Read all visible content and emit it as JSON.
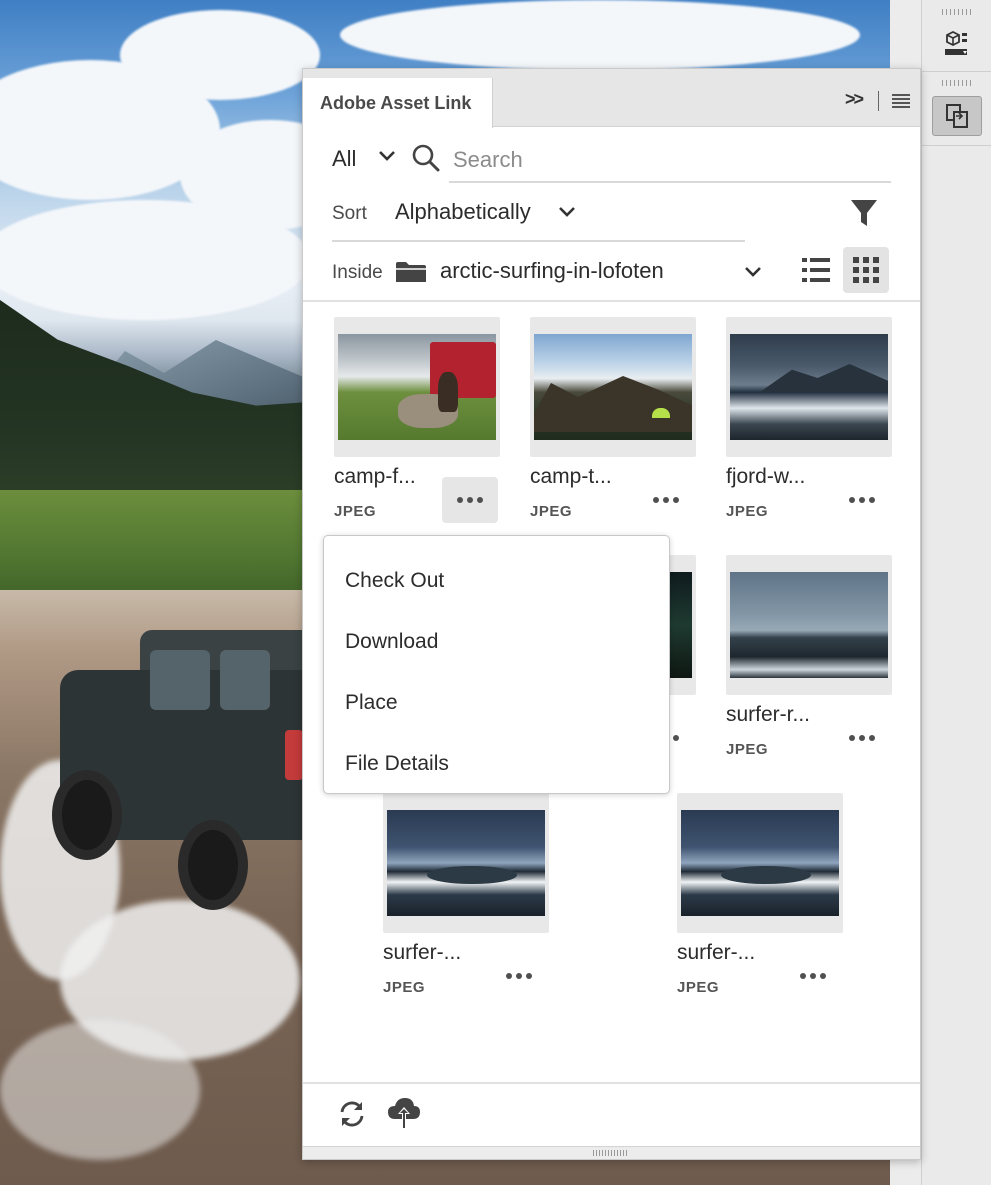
{
  "panel": {
    "title": "Adobe Asset Link",
    "collapse_glyph": ">>"
  },
  "search": {
    "scope": "All",
    "placeholder": "Search",
    "value": ""
  },
  "sort": {
    "label": "Sort",
    "value": "Alphabetically"
  },
  "location": {
    "label": "Inside",
    "folder": "arctic-surfing-in-lofoten"
  },
  "view_mode": "grid",
  "assets": [
    {
      "name": "camp-f...",
      "type": "JPEG",
      "menu_open": true
    },
    {
      "name": "camp-t...",
      "type": "JPEG"
    },
    {
      "name": "fjord-w...",
      "type": "JPEG"
    },
    {
      "name": "",
      "type": ""
    },
    {
      "name": "",
      "type": ""
    },
    {
      "name": "surfer-r...",
      "type": "JPEG"
    },
    {
      "name": "surfer-...",
      "type": "JPEG"
    },
    {
      "name": "surfer-...",
      "type": "JPEG"
    }
  ],
  "context_menu": {
    "items": [
      "Check Out",
      "Download",
      "Place",
      "File Details"
    ]
  },
  "footer": {
    "icons": [
      "refresh-icon",
      "cloud-upload-icon"
    ]
  },
  "tool_rail": {
    "icons": [
      "3d-cube-icon",
      "asset-link-icon"
    ]
  },
  "colors": {
    "panel_bg": "#ffffff",
    "tab_bar_bg": "#e6e6e6",
    "text": "#2c2c2c",
    "thumb_bg": "#e8e8e8",
    "active_button_bg": "#e3e3e3"
  }
}
